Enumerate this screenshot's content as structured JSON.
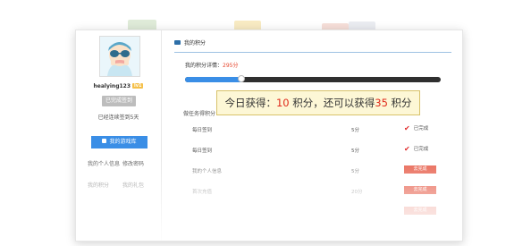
{
  "header": {
    "title": "我的积分"
  },
  "user": {
    "name": "healying123",
    "level": "lv1",
    "signed_button": "已完成签到",
    "streak_text": "已经连续签到5天"
  },
  "sidebar": {
    "my_button": "我的游戏库",
    "menu": [
      "我的个人信息",
      "修改密码",
      "我的积分",
      "我的礼包"
    ]
  },
  "points": {
    "label": "我的积分详情：",
    "value": "295分",
    "progress": 0.22
  },
  "tasks": {
    "section_label": "做任务得积分",
    "rows": [
      {
        "name": "每日签到",
        "points": "5分",
        "status": "已完成",
        "done": true
      },
      {
        "name": "每日签到",
        "points": "5分",
        "status": "已完成",
        "done": true
      },
      {
        "name": "我的个人信息",
        "points": "5分",
        "status": "去完成",
        "done": false
      },
      {
        "name": "首次充值",
        "points": "20分",
        "status": "去完成",
        "done": false
      },
      {
        "name": "",
        "points": "",
        "status": "去完成",
        "done": false
      }
    ]
  },
  "tooltip": {
    "prefix": "今日获得：",
    "earned": "10",
    "middle": "积分，还可以获得",
    "remaining": "35",
    "suffix": "积分"
  },
  "colors": {
    "accent": "#3a8ee6",
    "highlight": "#e02a1b",
    "tooltip_bg": "#fdf7d6"
  }
}
